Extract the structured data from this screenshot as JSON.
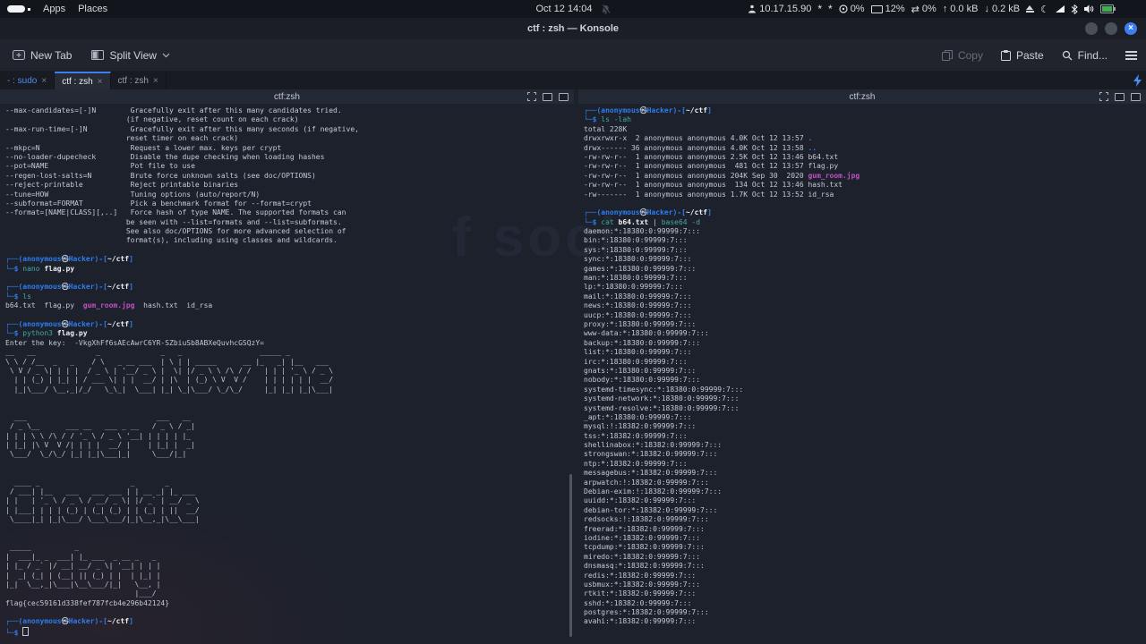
{
  "panel": {
    "apps": "Apps",
    "places": "Places",
    "clock": "Oct 12 14:04",
    "ip": "10.17.15.90",
    "cpu": "0%",
    "mem": "12%",
    "net": "0%",
    "up": "0.0 kB",
    "down": "0.2 kB"
  },
  "icons": {
    "close_tab": "×",
    "window_close": "×",
    "moon": "☾",
    "net_arrows": "⇄",
    "up_arrow": "↑",
    "down_arrow": "↓",
    "tray_star": "*"
  },
  "titlebar": {
    "title": "ctf : zsh — Konsole"
  },
  "toolbar": {
    "new_tab": "New Tab",
    "split_view": "Split View",
    "copy": "Copy",
    "paste": "Paste",
    "find": "Find..."
  },
  "tabs": [
    {
      "label": "- : sudo"
    },
    {
      "label": "ctf : zsh"
    },
    {
      "label": "ctf : zsh"
    }
  ],
  "watermark": {
    "text": "f soci"
  },
  "panes": {
    "left": {
      "title": "ctf:zsh",
      "lines": [
        "--max-candidates=[-]N        Gracefully exit after this many candidates tried.",
        "                            (if negative, reset count on each crack)",
        "--max-run-time=[-]N          Gracefully exit after this many seconds (if negative,",
        "                            reset timer on each crack)",
        "--mkpc=N                     Request a lower max. keys per crypt",
        "--no-loader-dupecheck        Disable the dupe checking when loading hashes",
        "--pot=NAME                   Pot file to use",
        "--regen-lost-salts=N         Brute force unknown salts (see doc/OPTIONS)",
        "--reject-printable           Reject printable binaries",
        "--tune=HOW                   Tuning options (auto/report/N)",
        "--subformat=FORMAT           Pick a benchmark format for --format=crypt",
        "--format=[NAME|CLASS][,..]   Force hash of type NAME. The supported formats can",
        "                            be seen with --list=formats and --list=subformats.",
        "                            See also doc/OPTIONS for more advanced selection of",
        "                            format(s), including using classes and wildcards.",
        "",
        [
          [
            "p",
            "┌──("
          ],
          [
            "p",
            "anonymous"
          ],
          [
            "k",
            "㉿"
          ],
          [
            "p",
            "Hacker"
          ],
          [
            "p",
            ")-["
          ],
          [
            "w",
            "~/ctf"
          ],
          [
            "p",
            "]"
          ]
        ],
        [
          [
            "p",
            "└─$ "
          ],
          [
            "c",
            "nano "
          ],
          [
            "w",
            "flag.py"
          ]
        ],
        "",
        [
          [
            "p",
            "┌──("
          ],
          [
            "p",
            "anonymous"
          ],
          [
            "k",
            "㉿"
          ],
          [
            "p",
            "Hacker"
          ],
          [
            "p",
            ")-["
          ],
          [
            "w",
            "~/ctf"
          ],
          [
            "p",
            "]"
          ]
        ],
        [
          [
            "p",
            "└─$ "
          ],
          [
            "c",
            "ls"
          ]
        ],
        [
          [
            "t",
            "b64.txt  flag.py  "
          ],
          [
            "m",
            "gum_room.jpg"
          ],
          [
            "t",
            "  hash.txt  id_rsa"
          ]
        ],
        "",
        [
          [
            "p",
            "┌──("
          ],
          [
            "p",
            "anonymous"
          ],
          [
            "k",
            "㉿"
          ],
          [
            "p",
            "Hacker"
          ],
          [
            "p",
            ")-["
          ],
          [
            "w",
            "~/ctf"
          ],
          [
            "p",
            "]"
          ]
        ],
        [
          [
            "p",
            "└─$ "
          ],
          [
            "c",
            "python3 "
          ],
          [
            "w",
            "flag.py"
          ]
        ],
        "Enter the key:  -VkgXhFf6sAEcAwrC6YR-SZbiuSb8ABXeQuvhcGSQzY=",
        "__   __              _              _   _                  _____ _          ",
        "\\ \\ / /__  _   _    / \\   _ __ ___  | \\ | | _____      __ |_   _| |__   ___ ",
        " \\ V / _ \\| | | |  / _ \\ | '__/ _ \\ |  \\| |/ _ \\ \\ /\\ / /   | | | '_ \\ / _ \\",
        "  | | (_) | |_| | / ___ \\| | |  __/ | |\\  | (_) \\ V  V /    | | | | | |  __/",
        "  |_|\\___/ \\__,_|/_/   \\_\\_|  \\___| |_| \\_|\\___/ \\_/\\_/     |_| |_| |_|\\___|",
        "",
        "",
        "  ___                              ___   __ ",
        " / _ \\__      ___ __   ___ _ __   / _ \\ / _|",
        "| | | \\ \\ /\\ / / '_ \\ / _ \\ '__| | | | | |_ ",
        "| |_| |\\ V  V /| | | |  __/ |    | |_| |  _|",
        " \\___/  \\_/\\_/ |_| |_|\\___|_|     \\___/|_|  ",
        "",
        "",
        "  ____ _                     _       _       ",
        " / ___| |__   ___   ___ ___ | | __ _| |_ ___ ",
        "| |   | '_ \\ / _ \\ / __/ _ \\| |/ _` | __/ _ \\",
        "| |___| | | | (_) | (_| (_) | | (_| | ||  __/",
        " \\____|_| |_|\\___/ \\___\\___/|_|\\__,_|\\__\\___|",
        "",
        "",
        " _____          _                   ",
        "|  ___|_ _  ___| |_ ___  _ __ _   _ ",
        "| |_ / _` |/ __| __/ _ \\| '__| | | |",
        "|  _| (_| | (__| || (_) | |  | |_| |",
        "|_|  \\__,_|\\___|\\__\\___/|_|   \\__, |",
        "                              |___/ ",
        "flag{cec59161d338fef787fcb4e296b42124}",
        "",
        [
          [
            "p",
            "┌──("
          ],
          [
            "p",
            "anonymous"
          ],
          [
            "k",
            "㉿"
          ],
          [
            "p",
            "Hacker"
          ],
          [
            "p",
            ")-["
          ],
          [
            "w",
            "~/ctf"
          ],
          [
            "p",
            "]"
          ]
        ],
        [
          [
            "p",
            "└─$ "
          ],
          [
            "cur",
            ""
          ]
        ]
      ]
    },
    "right": {
      "title": "ctf:zsh",
      "lines": [
        [
          [
            "p",
            "┌──("
          ],
          [
            "p",
            "anonymous"
          ],
          [
            "k",
            "㉿"
          ],
          [
            "p",
            "Hacker"
          ],
          [
            "p",
            ")-["
          ],
          [
            "w",
            "~/ctf"
          ],
          [
            "p",
            "]"
          ]
        ],
        [
          [
            "p",
            "└─$ "
          ],
          [
            "c",
            "ls -lah"
          ]
        ],
        "total 228K",
        [
          [
            "t",
            "drwxrwxr-x  2 anonymous anonymous 4.0K Oct 12 13:57 "
          ],
          [
            "d",
            "."
          ]
        ],
        [
          [
            "t",
            "drwx------ 36 anonymous anonymous 4.0K Oct 12 13:58 "
          ],
          [
            "d",
            ".."
          ]
        ],
        "-rw-rw-r--  1 anonymous anonymous 2.5K Oct 12 13:46 b64.txt",
        "-rw-rw-r--  1 anonymous anonymous  481 Oct 12 13:57 flag.py",
        [
          [
            "t",
            "-rw-rw-r--  1 anonymous anonymous 204K Sep 30  2020 "
          ],
          [
            "m",
            "gum_room.jpg"
          ]
        ],
        "-rw-rw-r--  1 anonymous anonymous  134 Oct 12 13:46 hash.txt",
        "-rw-------  1 anonymous anonymous 1.7K Oct 12 13:52 id_rsa",
        "",
        [
          [
            "p",
            "┌──("
          ],
          [
            "p",
            "anonymous"
          ],
          [
            "k",
            "㉿"
          ],
          [
            "p",
            "Hacker"
          ],
          [
            "p",
            ")-["
          ],
          [
            "w",
            "~/ctf"
          ],
          [
            "p",
            "]"
          ]
        ],
        [
          [
            "p",
            "└─$ "
          ],
          [
            "c",
            "cat "
          ],
          [
            "w",
            "b64.txt"
          ],
          [
            "t",
            " | "
          ],
          [
            "c",
            "base64 -d"
          ]
        ],
        "daemon:*:18380:0:99999:7:::",
        "bin:*:18380:0:99999:7:::",
        "sys:*:18380:0:99999:7:::",
        "sync:*:18380:0:99999:7:::",
        "games:*:18380:0:99999:7:::",
        "man:*:18380:0:99999:7:::",
        "lp:*:18380:0:99999:7:::",
        "mail:*:18380:0:99999:7:::",
        "news:*:18380:0:99999:7:::",
        "uucp:*:18380:0:99999:7:::",
        "proxy:*:18380:0:99999:7:::",
        "www-data:*:18380:0:99999:7:::",
        "backup:*:18380:0:99999:7:::",
        "list:*:18380:0:99999:7:::",
        "irc:*:18380:0:99999:7:::",
        "gnats:*:18380:0:99999:7:::",
        "nobody:*:18380:0:99999:7:::",
        "systemd-timesync:*:18380:0:99999:7:::",
        "systemd-network:*:18380:0:99999:7:::",
        "systemd-resolve:*:18380:0:99999:7:::",
        "_apt:*:18380:0:99999:7:::",
        "mysql:!:18382:0:99999:7:::",
        "tss:*:18382:0:99999:7:::",
        "shellinabox:*:18382:0:99999:7:::",
        "strongswan:*:18382:0:99999:7:::",
        "ntp:*:18382:0:99999:7:::",
        "messagebus:*:18382:0:99999:7:::",
        "arpwatch:!:18382:0:99999:7:::",
        "Debian-exim:!:18382:0:99999:7:::",
        "uuidd:*:18382:0:99999:7:::",
        "debian-tor:*:18382:0:99999:7:::",
        "redsocks:!:18382:0:99999:7:::",
        "freerad:*:18382:0:99999:7:::",
        "iodine:*:18382:0:99999:7:::",
        "tcpdump:*:18382:0:99999:7:::",
        "miredo:*:18382:0:99999:7:::",
        "dnsmasq:*:18382:0:99999:7:::",
        "redis:*:18382:0:99999:7:::",
        "usbmux:*:18382:0:99999:7:::",
        "rtkit:*:18382:0:99999:7:::",
        "sshd:*:18382:0:99999:7:::",
        "postgres:*:18382:0:99999:7:::",
        "avahi:*:18382:0:99999:7:::"
      ]
    }
  }
}
